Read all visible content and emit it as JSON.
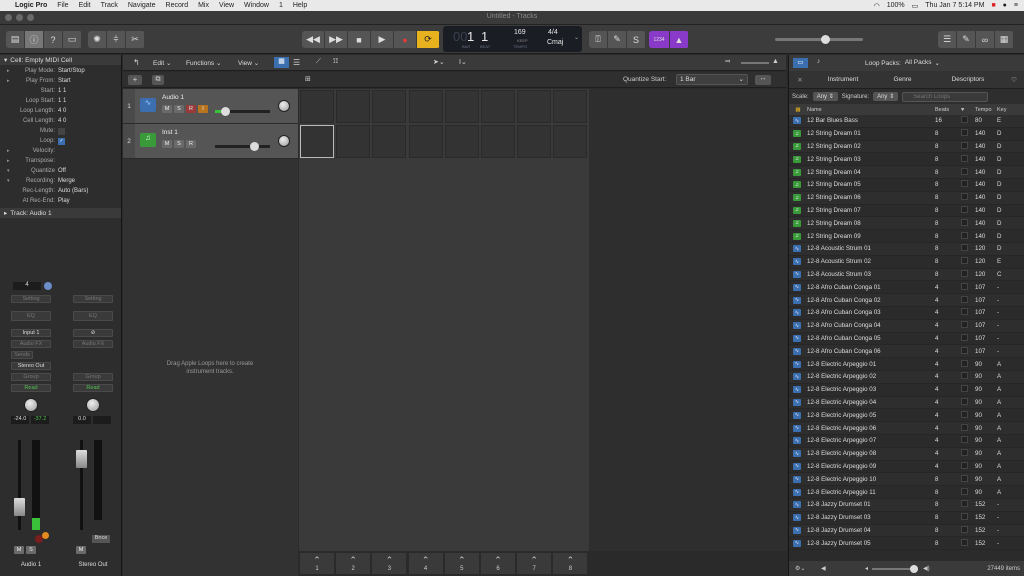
{
  "menubar": {
    "items": [
      "Logic Pro",
      "File",
      "Edit",
      "Track",
      "Navigate",
      "Record",
      "Mix",
      "View",
      "Window",
      "1",
      "Help"
    ],
    "battery": "100%",
    "clock": "Thu Jan 7  5:14 PM"
  },
  "window": {
    "title": "Untitled - Tracks"
  },
  "transport": {
    "bar": "1",
    "beat": "1",
    "bar_label": "BAR",
    "beat_label": "BEAT",
    "tempo": "169",
    "tempo_keep": "KEEP",
    "tempo_label": "TEMPO",
    "signature": "4/4",
    "key": "Cmaj",
    "count_in": "1234"
  },
  "inspector": {
    "header": "Cell: Empty MIDI Cell",
    "params": [
      {
        "k": "Play Mode:",
        "v": "Start/Stop"
      },
      {
        "k": "Play From:",
        "v": "Start"
      },
      {
        "k": "Start:",
        "v": "1  1"
      },
      {
        "k": "Loop Start:",
        "v": "1  1"
      },
      {
        "k": "Loop Length:",
        "v": "4  0"
      },
      {
        "k": "Cell Length:",
        "v": "4  0"
      },
      {
        "k": "Mute:",
        "v": ""
      },
      {
        "k": "Loop:",
        "v": "✓"
      },
      {
        "k": "Velocity:",
        "v": ""
      },
      {
        "k": "Transpose:",
        "v": ""
      },
      {
        "k": "Quantize",
        "v": "Off"
      },
      {
        "k": "Recording:",
        "v": "Merge"
      },
      {
        "k": "Rec-Length:",
        "v": "Auto (Bars)"
      },
      {
        "k": "At Rec-End:",
        "v": "Play"
      }
    ],
    "track_header": "Track:  Audio 1",
    "strip1": {
      "input_num": "4",
      "setting": "Setting",
      "eq": "EQ",
      "input": "Input 1",
      "audio_fx": "Audio FX",
      "sends": "Sends",
      "output": "Stereo Out",
      "group": "Group",
      "read": "Read",
      "vol": "-24.0",
      "peak": "-37.2",
      "name": "Audio 1",
      "m": "M",
      "s": "S"
    },
    "strip2": {
      "setting": "Setting",
      "eq": "EQ",
      "audio_fx": "Audio FX",
      "group": "Group",
      "read": "Read",
      "vol": "0.0",
      "name": "Stereo Out",
      "m": "M",
      "bnce": "Bnce"
    }
  },
  "toolbar": {
    "edit": "Edit",
    "functions": "Functions",
    "view": "View",
    "quantize_label": "Quantize Start:",
    "quantize_value": "1 Bar"
  },
  "tracks": [
    {
      "num": "1",
      "name": "Audio 1",
      "m": "M",
      "s": "S",
      "r": "R",
      "i": "I"
    },
    {
      "num": "2",
      "name": "Inst 1",
      "m": "M",
      "s": "S",
      "r": "R"
    }
  ],
  "drag_hint": "Drag Apple Loops here to create instrument tracks.",
  "scenes": [
    "1",
    "2",
    "3",
    "4",
    "5",
    "6",
    "7",
    "8"
  ],
  "loops": {
    "packs_label": "Loop Packs:",
    "packs_value": "All Packs",
    "tabs": [
      "Instrument",
      "Genre",
      "Descriptors"
    ],
    "scale_label": "Scale:",
    "scale_value": "Any",
    "signature_label": "Signature:",
    "signature_value": "Any",
    "search_placeholder": "Search Loops",
    "columns": {
      "name": "Name",
      "beats": "Beats",
      "tempo": "Tempo",
      "key": "Key"
    },
    "rows": [
      {
        "name": "12 Bar Blues Bass",
        "beats": "16",
        "tempo": "80",
        "key": "E",
        "type": "audio"
      },
      {
        "name": "12 String Dream 01",
        "beats": "8",
        "tempo": "140",
        "key": "D",
        "type": "midi"
      },
      {
        "name": "12 String Dream 02",
        "beats": "8",
        "tempo": "140",
        "key": "D",
        "type": "midi"
      },
      {
        "name": "12 String Dream 03",
        "beats": "8",
        "tempo": "140",
        "key": "D",
        "type": "midi"
      },
      {
        "name": "12 String Dream 04",
        "beats": "8",
        "tempo": "140",
        "key": "D",
        "type": "midi"
      },
      {
        "name": "12 String Dream 05",
        "beats": "8",
        "tempo": "140",
        "key": "D",
        "type": "midi"
      },
      {
        "name": "12 String Dream 06",
        "beats": "8",
        "tempo": "140",
        "key": "D",
        "type": "midi"
      },
      {
        "name": "12 String Dream 07",
        "beats": "8",
        "tempo": "140",
        "key": "D",
        "type": "midi"
      },
      {
        "name": "12 String Dream 08",
        "beats": "8",
        "tempo": "140",
        "key": "D",
        "type": "midi"
      },
      {
        "name": "12 String Dream 09",
        "beats": "8",
        "tempo": "140",
        "key": "D",
        "type": "midi"
      },
      {
        "name": "12-8 Acoustic Strum 01",
        "beats": "8",
        "tempo": "120",
        "key": "D",
        "type": "audio"
      },
      {
        "name": "12-8 Acoustic Strum 02",
        "beats": "8",
        "tempo": "120",
        "key": "E",
        "type": "audio"
      },
      {
        "name": "12-8 Acoustic Strum 03",
        "beats": "8",
        "tempo": "120",
        "key": "C",
        "type": "audio"
      },
      {
        "name": "12-8 Afro Cuban Conga 01",
        "beats": "4",
        "tempo": "107",
        "key": "-",
        "type": "audio"
      },
      {
        "name": "12-8 Afro Cuban Conga 02",
        "beats": "4",
        "tempo": "107",
        "key": "-",
        "type": "audio"
      },
      {
        "name": "12-8 Afro Cuban Conga 03",
        "beats": "4",
        "tempo": "107",
        "key": "-",
        "type": "audio"
      },
      {
        "name": "12-8 Afro Cuban Conga 04",
        "beats": "4",
        "tempo": "107",
        "key": "-",
        "type": "audio"
      },
      {
        "name": "12-8 Afro Cuban Conga 05",
        "beats": "4",
        "tempo": "107",
        "key": "-",
        "type": "audio"
      },
      {
        "name": "12-8 Afro Cuban Conga 06",
        "beats": "4",
        "tempo": "107",
        "key": "-",
        "type": "audio"
      },
      {
        "name": "12-8 Electric Arpeggio 01",
        "beats": "4",
        "tempo": "90",
        "key": "A",
        "type": "audio"
      },
      {
        "name": "12-8 Electric Arpeggio 02",
        "beats": "4",
        "tempo": "90",
        "key": "A",
        "type": "audio"
      },
      {
        "name": "12-8 Electric Arpeggio 03",
        "beats": "4",
        "tempo": "90",
        "key": "A",
        "type": "audio"
      },
      {
        "name": "12-8 Electric Arpeggio 04",
        "beats": "4",
        "tempo": "90",
        "key": "A",
        "type": "audio"
      },
      {
        "name": "12-8 Electric Arpeggio 05",
        "beats": "4",
        "tempo": "90",
        "key": "A",
        "type": "audio"
      },
      {
        "name": "12-8 Electric Arpeggio 06",
        "beats": "4",
        "tempo": "90",
        "key": "A",
        "type": "audio"
      },
      {
        "name": "12-8 Electric Arpeggio 07",
        "beats": "4",
        "tempo": "90",
        "key": "A",
        "type": "audio"
      },
      {
        "name": "12-8 Electric Arpeggio 08",
        "beats": "4",
        "tempo": "90",
        "key": "A",
        "type": "audio"
      },
      {
        "name": "12-8 Electric Arpeggio 09",
        "beats": "4",
        "tempo": "90",
        "key": "A",
        "type": "audio"
      },
      {
        "name": "12-8 Electric Arpeggio 10",
        "beats": "8",
        "tempo": "90",
        "key": "A",
        "type": "audio"
      },
      {
        "name": "12-8 Electric Arpeggio 11",
        "beats": "8",
        "tempo": "90",
        "key": "A",
        "type": "audio"
      },
      {
        "name": "12-8 Jazzy Drumset 01",
        "beats": "8",
        "tempo": "152",
        "key": "-",
        "type": "audio"
      },
      {
        "name": "12-8 Jazzy Drumset 03",
        "beats": "8",
        "tempo": "152",
        "key": "-",
        "type": "audio"
      },
      {
        "name": "12-8 Jazzy Drumset 04",
        "beats": "8",
        "tempo": "152",
        "key": "-",
        "type": "audio"
      },
      {
        "name": "12-8 Jazzy Drumset 05",
        "beats": "8",
        "tempo": "152",
        "key": "-",
        "type": "audio"
      }
    ],
    "item_count": "27449 items"
  },
  "colors": {
    "accent_blue": "#3b6fb0",
    "midi_green": "#3a9a3a",
    "cycle_yellow": "#e8b21e",
    "record_red": "#e03a3a",
    "count_in_purple": "#8a3ac8"
  }
}
